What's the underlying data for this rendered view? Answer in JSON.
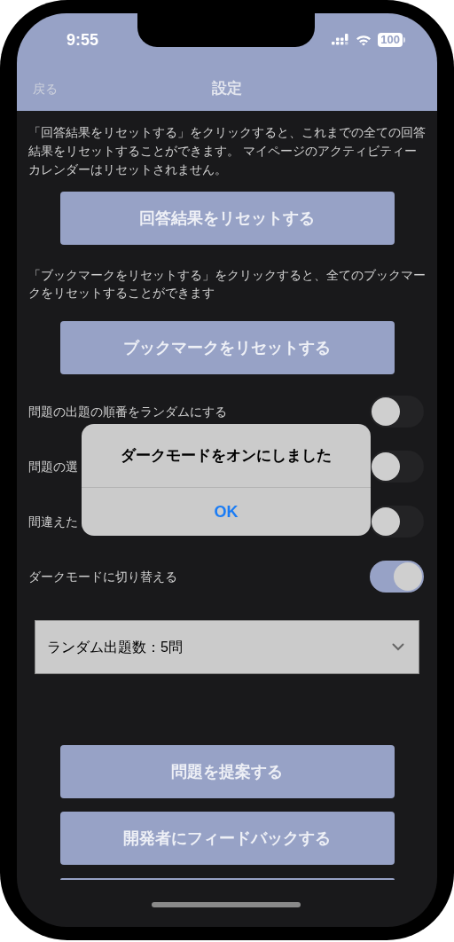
{
  "status_bar": {
    "time": "9:55",
    "battery": "100"
  },
  "nav": {
    "back": "戻る",
    "title": "設定"
  },
  "sections": [
    {
      "description": "「回答結果をリセットする」をクリックすると、これまでの全ての回答結果をリセットすることができます。 マイページのアクティビティーカレンダーはリセットされません。",
      "button": "回答結果をリセットする"
    },
    {
      "description": "「ブックマークをリセットする」をクリックすると、全てのブックマークをリセットすることができます",
      "button": "ブックマークをリセットする"
    }
  ],
  "toggles": [
    {
      "label": "問題の出題の順番をランダムにする",
      "on": false
    },
    {
      "label": "問題の選",
      "on": false
    },
    {
      "label": "間違えた",
      "on": false
    },
    {
      "label": "ダークモードに切り替える",
      "on": true
    }
  ],
  "dropdown": {
    "value": "ランダム出題数：5問"
  },
  "bottom_buttons": [
    "問題を提案する",
    "開発者にフィードバックする"
  ],
  "dialog": {
    "message": "ダークモードをオンにしました",
    "button": "OK"
  }
}
